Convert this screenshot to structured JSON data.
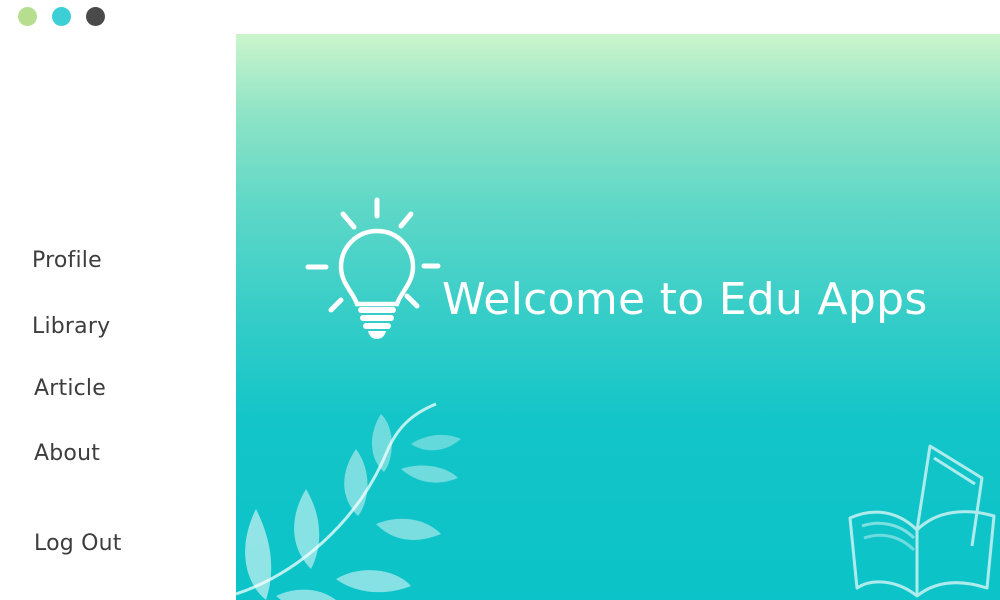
{
  "window": {
    "controls": [
      {
        "name": "minimize",
        "color": "#b6de8e"
      },
      {
        "name": "maximize",
        "color": "#3ccfd6"
      },
      {
        "name": "close",
        "color": "#4a4a4a"
      }
    ]
  },
  "sidebar": {
    "items": [
      {
        "label": "Profile"
      },
      {
        "label": "Library"
      },
      {
        "label": "Article"
      },
      {
        "label": "About"
      },
      {
        "label": "Log Out"
      }
    ]
  },
  "main": {
    "welcome_text": "Welcome to Edu Apps",
    "icons": [
      "lightbulb-icon",
      "leaves-decoration",
      "open-book-icon"
    ],
    "colors": {
      "gradient_top": "#cbf5cc",
      "gradient_bottom": "#0bc3c8",
      "text": "#ffffff"
    }
  }
}
